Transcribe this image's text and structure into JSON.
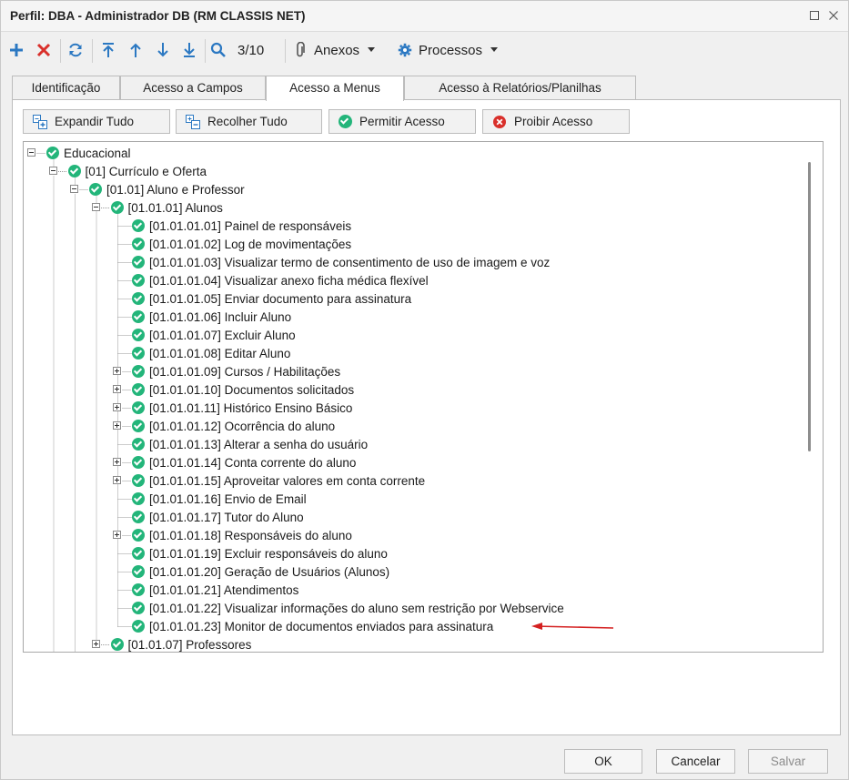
{
  "window": {
    "title": "Perfil: DBA - Administrador DB (RM CLASSIS NET)"
  },
  "toolbar": {
    "record_counter": "3/10",
    "attachments_label": "Anexos",
    "processes_label": "Processos"
  },
  "tabs": [
    {
      "label": "Identificação",
      "active": false
    },
    {
      "label": "Acesso a Campos",
      "active": false
    },
    {
      "label": "Acesso a Menus",
      "active": true
    },
    {
      "label": "Acesso à Relatórios/Planilhas",
      "active": false
    }
  ],
  "actions": {
    "expand_all": "Expandir Tudo",
    "collapse_all": "Recolher Tudo",
    "allow_access": "Permitir Acesso",
    "deny_access": "Proibir Acesso"
  },
  "tree": {
    "nodes": [
      {
        "label": "Educacional"
      },
      {
        "label": "[01] Currículo e Oferta"
      },
      {
        "label": "[01.01] Aluno e Professor"
      },
      {
        "label": "[01.01.01] Alunos"
      },
      {
        "label": "[01.01.01.01] Painel de responsáveis"
      },
      {
        "label": "[01.01.01.02] Log de movimentações"
      },
      {
        "label": "[01.01.01.03] Visualizar termo de consentimento de uso de imagem e voz"
      },
      {
        "label": "[01.01.01.04] Visualizar anexo ficha médica flexível"
      },
      {
        "label": "[01.01.01.05] Enviar documento para assinatura"
      },
      {
        "label": "[01.01.01.06] Incluir Aluno"
      },
      {
        "label": "[01.01.01.07] Excluir Aluno"
      },
      {
        "label": "[01.01.01.08] Editar Aluno"
      },
      {
        "label": "[01.01.01.09] Cursos / Habilitações"
      },
      {
        "label": "[01.01.01.10] Documentos solicitados"
      },
      {
        "label": "[01.01.01.11] Histórico Ensino Básico"
      },
      {
        "label": "[01.01.01.12] Ocorrência do aluno"
      },
      {
        "label": "[01.01.01.13] Alterar a senha do usuário"
      },
      {
        "label": "[01.01.01.14] Conta corrente do aluno"
      },
      {
        "label": "[01.01.01.15] Aproveitar valores em conta corrente"
      },
      {
        "label": "[01.01.01.16] Envio de Email"
      },
      {
        "label": "[01.01.01.17] Tutor do Aluno"
      },
      {
        "label": "[01.01.01.18] Responsáveis do aluno"
      },
      {
        "label": "[01.01.01.19] Excluir responsáveis do aluno"
      },
      {
        "label": "[01.01.01.20] Geração de Usuários (Alunos)"
      },
      {
        "label": "[01.01.01.21] Atendimentos"
      },
      {
        "label": "[01.01.01.22] Visualizar informações do aluno sem restrição por Webservice"
      },
      {
        "label": "[01.01.01.23] Monitor de documentos enviados para assinatura"
      },
      {
        "label": "[01.01.07] Professores"
      }
    ]
  },
  "footer": {
    "ok": "OK",
    "cancel": "Cancelar",
    "save": "Salvar"
  },
  "colors": {
    "check_green": "#23b57a",
    "toolbar_blue": "#2b78c2",
    "delete_red": "#d9302b",
    "arrow_red": "#d42020"
  },
  "icons": [
    "plus-icon",
    "delete-icon",
    "refresh-icon",
    "first-record-icon",
    "previous-record-icon",
    "next-record-icon",
    "last-record-icon",
    "search-icon",
    "paperclip-icon",
    "gear-icon",
    "caret-down-icon",
    "expand-all-icon",
    "collapse-all-icon",
    "allow-icon",
    "deny-icon",
    "check-icon",
    "close-icon",
    "maximize-icon"
  ]
}
